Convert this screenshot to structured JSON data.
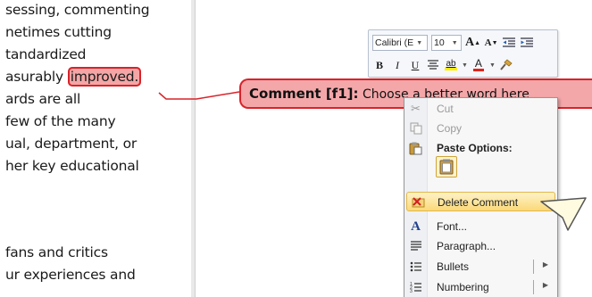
{
  "document": {
    "lines": [
      "sessing, commenting",
      "netimes cutting",
      "tandardized",
      "asurably ",
      "ards are all",
      "few of the many",
      "ual, department, or",
      "her key educational",
      "",
      "",
      "fans and critics",
      "ur experiences and"
    ],
    "highlighted_word": "improved."
  },
  "mini_toolbar": {
    "font_name": "Calibri (E",
    "font_size": "10",
    "grow_font": "A",
    "shrink_font": "A",
    "bold": "B",
    "italic": "I",
    "underline": "U",
    "highlight": "ab",
    "font_color": "A"
  },
  "comment": {
    "label": "Comment [f1]:",
    "text": " Choose a better word here"
  },
  "context_menu": {
    "cut": "Cut",
    "copy": "Copy",
    "paste_options": "Paste Options:",
    "delete_comment": "Delete Comment",
    "font": "Font...",
    "paragraph": "Paragraph...",
    "bullets": "Bullets",
    "numbering": "Numbering"
  },
  "colors": {
    "comment_fill": "#f4a7a9",
    "comment_border": "#d8232a",
    "menu_highlight": "#fbd979"
  }
}
